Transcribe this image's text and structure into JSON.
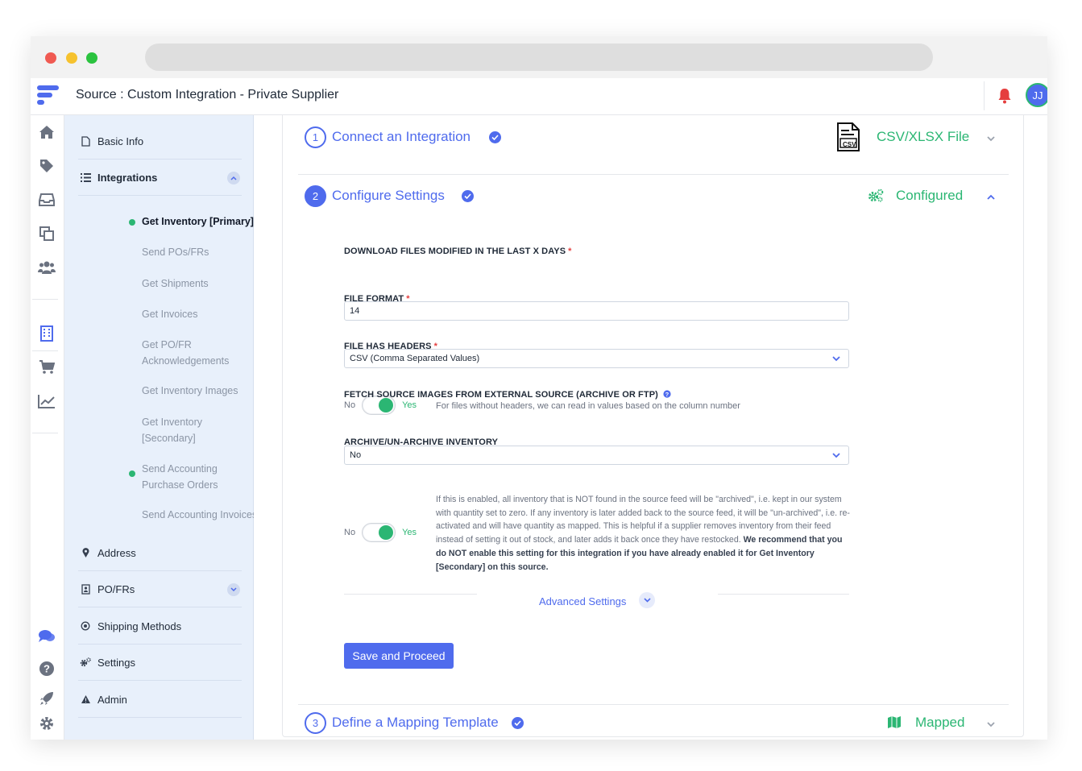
{
  "header": {
    "title": "Source :  Custom Integration - Private Supplier",
    "avatar_initials": "JJ"
  },
  "colors": {
    "primary": "#4f6bed",
    "success": "#2bb673",
    "danger": "#e53e3e",
    "sidebar_bg": "#e8f0fb"
  },
  "rail_icons": [
    "home-icon",
    "tag-icon",
    "inbox-icon",
    "copy-icon",
    "users-icon",
    "building-icon",
    "cart-icon",
    "chart-icon",
    "chat-icon",
    "help-icon",
    "rocket-icon",
    "gear-icon"
  ],
  "sidebar": {
    "items": [
      {
        "label": "Basic Info",
        "icon": "file-icon"
      },
      {
        "label": "Integrations",
        "icon": "list-icon"
      },
      {
        "label": "Address",
        "icon": "pin-icon"
      },
      {
        "label": "PO/FRs",
        "icon": "contact-icon"
      },
      {
        "label": "Shipping Methods",
        "icon": "dot-circle-icon"
      },
      {
        "label": "Settings",
        "icon": "gears-icon"
      },
      {
        "label": "Admin",
        "icon": "warning-icon"
      }
    ],
    "sub_items": [
      {
        "label": "Get Inventory [Primary]"
      },
      {
        "label": "Send POs/FRs"
      },
      {
        "label": "Get Shipments"
      },
      {
        "label": "Get Invoices"
      },
      {
        "label": "Get PO/FR Acknowledgements"
      },
      {
        "label": "Get Inventory Images"
      },
      {
        "label": "Get Inventory [Secondary]"
      },
      {
        "label": "Send Accounting Purchase Orders"
      },
      {
        "label": "Send Accounting Invoices"
      }
    ]
  },
  "steps": [
    {
      "number": "1",
      "title": "Connect an Integration",
      "status": "CSV/XLSX File",
      "file_badge": "CSV"
    },
    {
      "number": "2",
      "title": "Configure Settings",
      "status": "Configured"
    },
    {
      "number": "3",
      "title": "Define a Mapping Template",
      "status": "Mapped"
    }
  ],
  "form": {
    "days_label": "DOWNLOAD FILES MODIFIED IN THE LAST X DAYS",
    "days_value": "14",
    "format_label": "FILE FORMAT",
    "format_value": "CSV (Comma Separated Values)",
    "headers_label": "FILE HAS HEADERS",
    "toggle_no": "No",
    "toggle_yes": "Yes",
    "headers_help": "For files without headers, we can read in values based on the column number",
    "images_label": "FETCH SOURCE IMAGES FROM EXTERNAL SOURCE (ARCHIVE OR FTP)",
    "images_value": "No",
    "archive_label": "ARCHIVE/UN-ARCHIVE INVENTORY",
    "archive_help": "If this is enabled, all inventory that is NOT found in the source feed will be \"archived\", i.e. kept in our system with quantity set to zero. If any inventory is later added back to the source feed, it will be \"un-archived\", i.e. re-activated and will have quantity as mapped. This is helpful if a supplier removes inventory from their feed instead of setting it out of stock, and later adds it back once they have restocked.",
    "archive_help_bold": "We recommend that you do NOT enable this setting for this integration if you have already enabled it for Get Inventory [Secondary] on this source.",
    "advanced_label": "Advanced Settings",
    "save_label": "Save and Proceed"
  }
}
